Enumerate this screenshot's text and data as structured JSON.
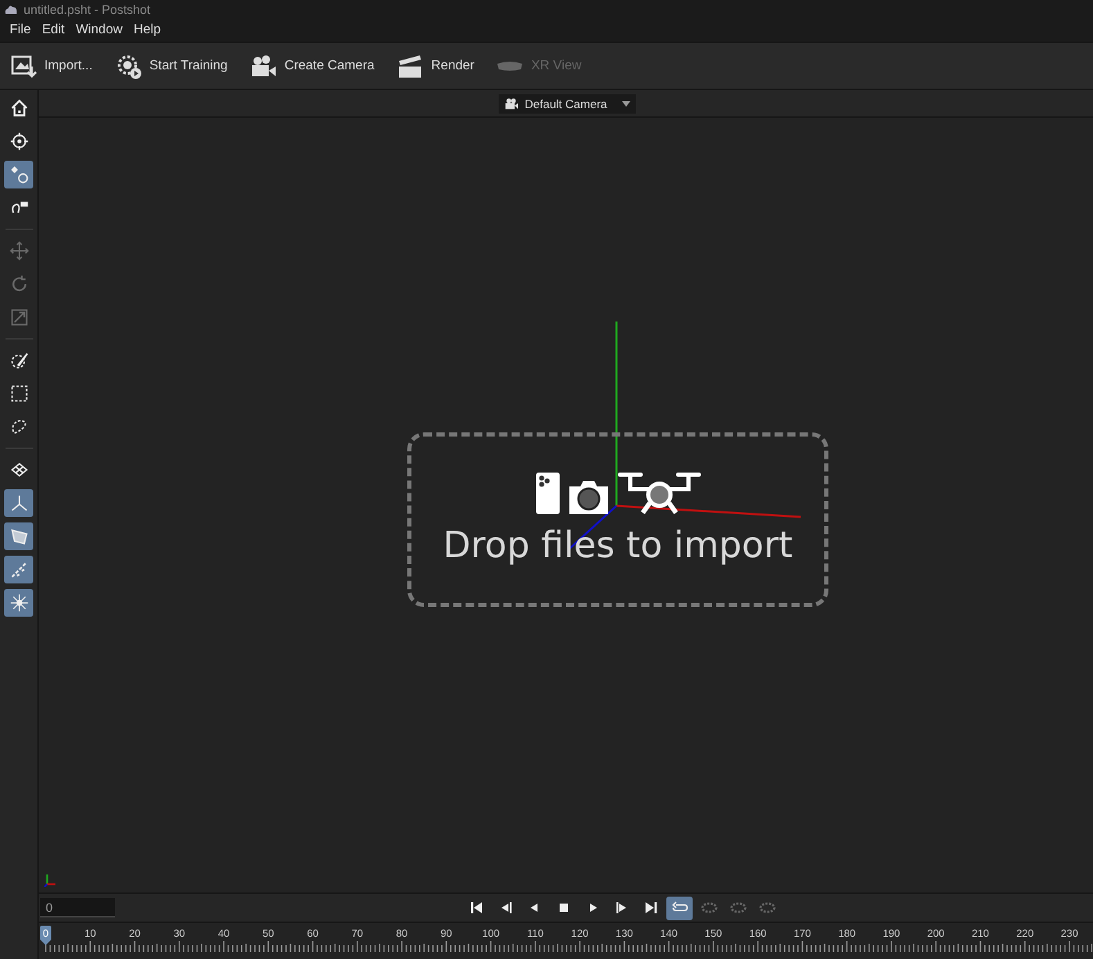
{
  "window": {
    "title": "untitled.psht - Postshot"
  },
  "menu": [
    "File",
    "Edit",
    "Window",
    "Help"
  ],
  "toolbar": [
    {
      "kind": "import",
      "label": "Import...",
      "disabled": false
    },
    {
      "kind": "train",
      "label": "Start Training",
      "disabled": false
    },
    {
      "kind": "camera",
      "label": "Create Camera",
      "disabled": false
    },
    {
      "kind": "render",
      "label": "Render",
      "disabled": false
    },
    {
      "kind": "xr",
      "label": "XR View",
      "disabled": true
    }
  ],
  "tool_groups": [
    {
      "tools": [
        {
          "kind": "home",
          "selected": false,
          "disabled": false
        },
        {
          "kind": "target",
          "selected": false,
          "disabled": false
        },
        {
          "kind": "select",
          "selected": true,
          "disabled": false
        },
        {
          "kind": "flag",
          "selected": false,
          "disabled": false
        }
      ]
    },
    {
      "tools": [
        {
          "kind": "move",
          "selected": false,
          "disabled": true
        },
        {
          "kind": "rotate",
          "selected": false,
          "disabled": true
        },
        {
          "kind": "scale",
          "selected": false,
          "disabled": true
        }
      ]
    },
    {
      "tools": [
        {
          "kind": "brush",
          "selected": false,
          "disabled": false
        },
        {
          "kind": "rect",
          "selected": false,
          "disabled": false
        },
        {
          "kind": "lasso",
          "selected": false,
          "disabled": false
        }
      ]
    },
    {
      "tools": [
        {
          "kind": "plane",
          "selected": false,
          "disabled": false
        },
        {
          "kind": "axes",
          "selected": true,
          "disabled": false
        },
        {
          "kind": "frustum",
          "selected": true,
          "disabled": false
        },
        {
          "kind": "points",
          "selected": true,
          "disabled": false
        },
        {
          "kind": "splat",
          "selected": true,
          "disabled": false
        }
      ]
    }
  ],
  "camera_select": {
    "value": "Default Camera"
  },
  "drop_zone": {
    "text": "Drop files to import"
  },
  "frame_field": {
    "value": "0"
  },
  "transport": [
    {
      "kind": "first",
      "selected": false,
      "disabled": false
    },
    {
      "kind": "prev",
      "selected": false,
      "disabled": false
    },
    {
      "kind": "back",
      "selected": false,
      "disabled": false
    },
    {
      "kind": "stop",
      "selected": false,
      "disabled": false
    },
    {
      "kind": "play",
      "selected": false,
      "disabled": false
    },
    {
      "kind": "next",
      "selected": false,
      "disabled": false
    },
    {
      "kind": "last",
      "selected": false,
      "disabled": false
    },
    {
      "kind": "loop",
      "selected": true,
      "disabled": false
    },
    {
      "kind": "once",
      "selected": false,
      "disabled": true
    },
    {
      "kind": "bounce",
      "selected": false,
      "disabled": true
    },
    {
      "kind": "shuffle",
      "selected": false,
      "disabled": true
    }
  ],
  "timeline": {
    "labels": [
      "0",
      "10",
      "20",
      "30",
      "40",
      "50",
      "60",
      "70",
      "80",
      "90",
      "100",
      "110",
      "120",
      "130",
      "140",
      "150",
      "160",
      "170",
      "180",
      "190",
      "200",
      "210",
      "220",
      "230"
    ]
  }
}
